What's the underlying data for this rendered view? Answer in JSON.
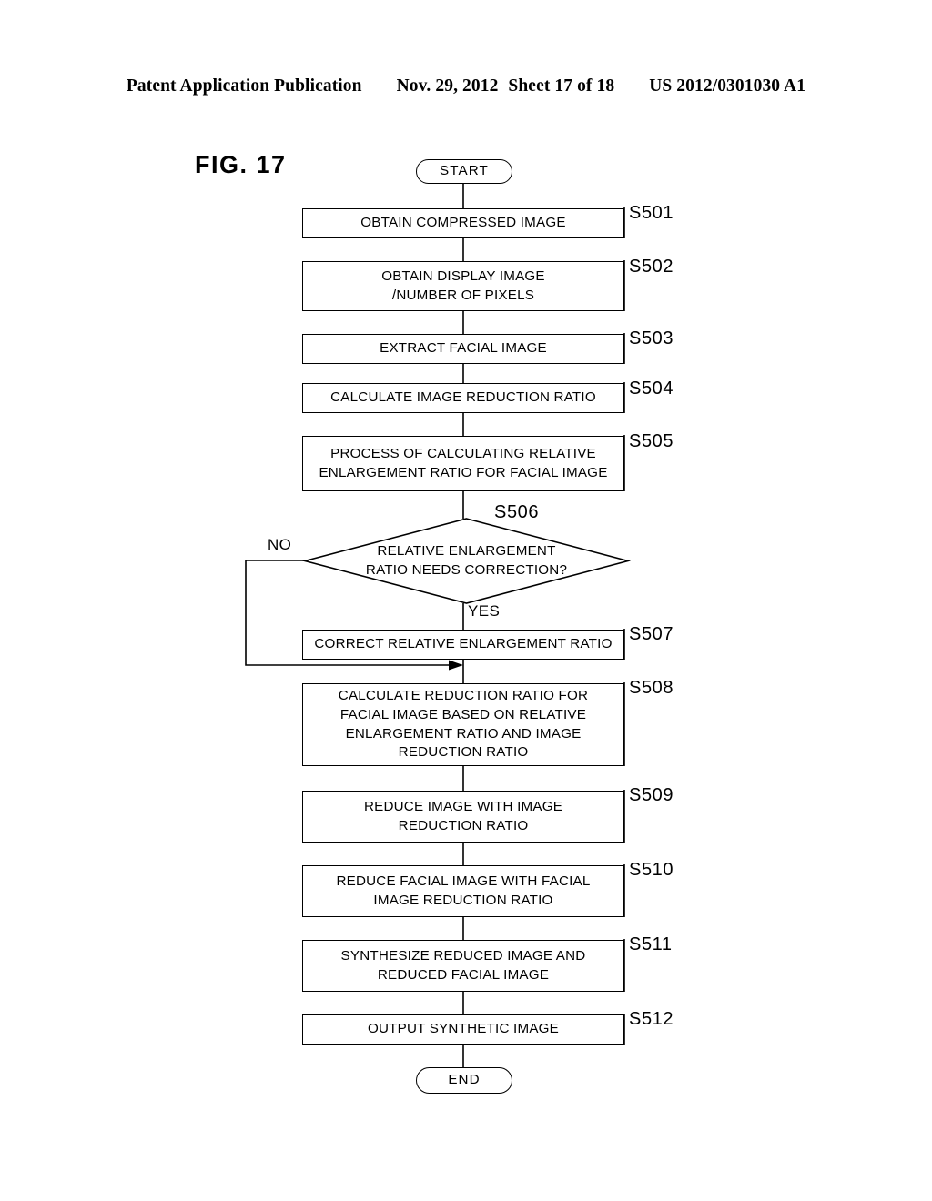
{
  "header": {
    "publication": "Patent Application Publication",
    "date": "Nov. 29, 2012",
    "sheet": "Sheet 17 of 18",
    "number": "US 2012/0301030 A1"
  },
  "figure": {
    "label": "FIG. 17"
  },
  "flowchart": {
    "start_label": "START",
    "end_label": "END",
    "branch_no": "NO",
    "branch_yes": "YES",
    "steps": [
      {
        "ref": "S501",
        "text": "OBTAIN COMPRESSED IMAGE"
      },
      {
        "ref": "S502",
        "text": "OBTAIN DISPLAY IMAGE\n/NUMBER OF PIXELS"
      },
      {
        "ref": "S503",
        "text": "EXTRACT FACIAL IMAGE"
      },
      {
        "ref": "S504",
        "text": "CALCULATE IMAGE REDUCTION RATIO"
      },
      {
        "ref": "S505",
        "text": "PROCESS OF CALCULATING RELATIVE\nENLARGEMENT RATIO FOR FACIAL IMAGE"
      },
      {
        "ref": "S506",
        "text": "RELATIVE ENLARGEMENT\nRATIO NEEDS CORRECTION?"
      },
      {
        "ref": "S507",
        "text": "CORRECT RELATIVE ENLARGEMENT RATIO"
      },
      {
        "ref": "S508",
        "text": "CALCULATE REDUCTION RATIO FOR\nFACIAL IMAGE BASED ON RELATIVE\nENLARGEMENT RATIO AND IMAGE\nREDUCTION RATIO"
      },
      {
        "ref": "S509",
        "text": "REDUCE IMAGE WITH IMAGE\nREDUCTION RATIO"
      },
      {
        "ref": "S510",
        "text": "REDUCE FACIAL IMAGE WITH FACIAL\nIMAGE REDUCTION RATIO"
      },
      {
        "ref": "S511",
        "text": "SYNTHESIZE REDUCED IMAGE AND\nREDUCED FACIAL IMAGE"
      },
      {
        "ref": "S512",
        "text": "OUTPUT SYNTHETIC IMAGE"
      }
    ]
  },
  "colors": {
    "ink": "#000000",
    "paper": "#ffffff"
  }
}
